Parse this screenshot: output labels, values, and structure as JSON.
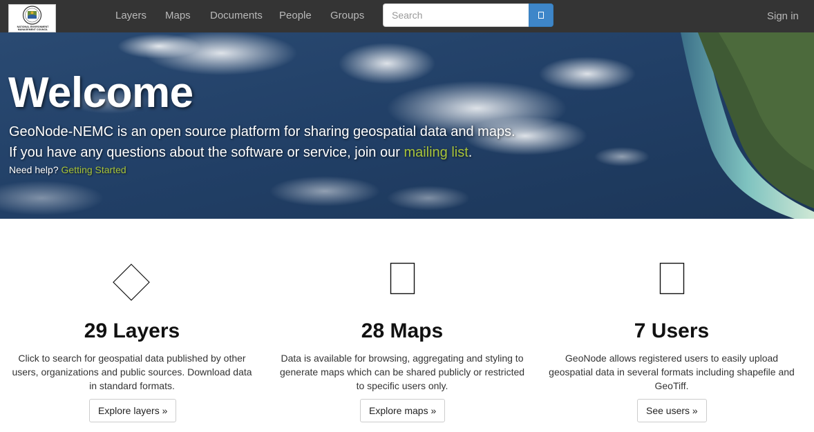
{
  "brand": {
    "logo_text_line1": "NATIONAL ENVIRONMENT",
    "logo_text_line2": "MANAGEMENT COUNCIL"
  },
  "nav": {
    "items": [
      {
        "label": "Layers"
      },
      {
        "label": "Maps"
      },
      {
        "label": "Documents"
      },
      {
        "label": "People"
      },
      {
        "label": "Groups"
      }
    ],
    "sign_in": "Sign in"
  },
  "search": {
    "placeholder": "Search",
    "value": "",
    "button_glyph": "▯",
    "icon": "search-icon"
  },
  "hero": {
    "title": "Welcome",
    "line1": "GeoNode-NEMC is an open source platform for sharing geospatial data and maps.",
    "line2_prefix": "If you have any questions about the software or service, join our ",
    "line2_link": "mailing list",
    "line2_suffix": ".",
    "help_prefix": "Need help? ",
    "help_link": "Getting Started"
  },
  "features": [
    {
      "icon": "layers-icon",
      "title": "29 Layers",
      "description": "Click to search for geospatial data published by other users, organizations and public sources. Download data in standard formats.",
      "button": "Explore layers »"
    },
    {
      "icon": "map-icon",
      "title": "28 Maps",
      "description": "Data is available for browsing, aggregating and styling to generate maps which can be shared publicly or restricted to specific users only.",
      "button": "Explore maps »"
    },
    {
      "icon": "user-icon",
      "title": "7 Users",
      "description": "GeoNode allows registered users to easily upload geospatial data in several formats including shapefile and GeoTiff.",
      "button": "See users »"
    }
  ],
  "colors": {
    "navbar_bg": "#343434",
    "nav_text": "#b9b9b9",
    "search_button": "#3e86c9",
    "hero_link": "#a8c43a",
    "ocean": "#24436a"
  }
}
